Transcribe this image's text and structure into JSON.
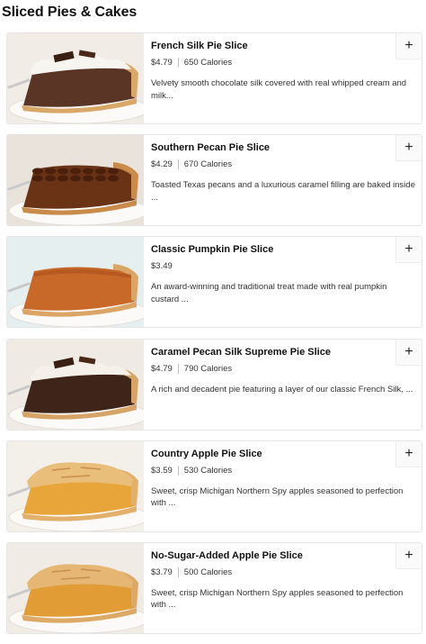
{
  "section": {
    "title": "Sliced Pies & Cakes"
  },
  "items": [
    {
      "name": "French Silk Pie Slice",
      "price": "$4.79",
      "calories": "650 Calories",
      "description": "Velvety smooth chocolate silk covered with real whipped cream and milk...",
      "add_icon": "plus-icon",
      "colors": {
        "bg": "#f1ece6",
        "filling": "#5a3425",
        "crust": "#d9a868",
        "top": "#f7f5f0"
      }
    },
    {
      "name": "Southern Pecan Pie Slice",
      "price": "$4.29",
      "calories": "670 Calories",
      "description": "Toasted Texas pecans and a luxurious caramel filling are baked inside ...",
      "add_icon": "plus-icon",
      "colors": {
        "bg": "#e9e3dc",
        "filling": "#6a3315",
        "crust": "#c98a4a",
        "top": "#4a200d"
      }
    },
    {
      "name": "Classic Pumpkin Pie Slice",
      "price": "$3.49",
      "calories": "",
      "description": "An award-winning and traditional treat made with real pumpkin custard ...",
      "add_icon": "plus-icon",
      "colors": {
        "bg": "#e6eff0",
        "filling": "#c8692a",
        "crust": "#dba566",
        "top": "#d67a35"
      }
    },
    {
      "name": "Caramel Pecan Silk Supreme Pie Slice",
      "price": "$4.79",
      "calories": "790 Calories",
      "description": "A rich and decadent pie featuring a layer of our classic French Silk, ...",
      "add_icon": "plus-icon",
      "colors": {
        "bg": "#efeae4",
        "filling": "#3f2419",
        "crust": "#d6a467",
        "top": "#f5f1ea"
      }
    },
    {
      "name": "Country Apple Pie Slice",
      "price": "$3.59",
      "calories": "530 Calories",
      "description": "Sweet, crisp Michigan Northern Spy apples seasoned to perfection with ...",
      "add_icon": "plus-icon",
      "colors": {
        "bg": "#f3efe9",
        "filling": "#e8a63a",
        "crust": "#e2b06a",
        "top": "#e9bd7a"
      }
    },
    {
      "name": "No-Sugar-Added Apple Pie Slice",
      "price": "$3.79",
      "calories": "500 Calories",
      "description": "Sweet, crisp Michigan Northern Spy apples seasoned to perfection with ...",
      "add_icon": "plus-icon",
      "colors": {
        "bg": "#f0ebe5",
        "filling": "#e19c36",
        "crust": "#dcaa66",
        "top": "#e6b774"
      }
    }
  ]
}
